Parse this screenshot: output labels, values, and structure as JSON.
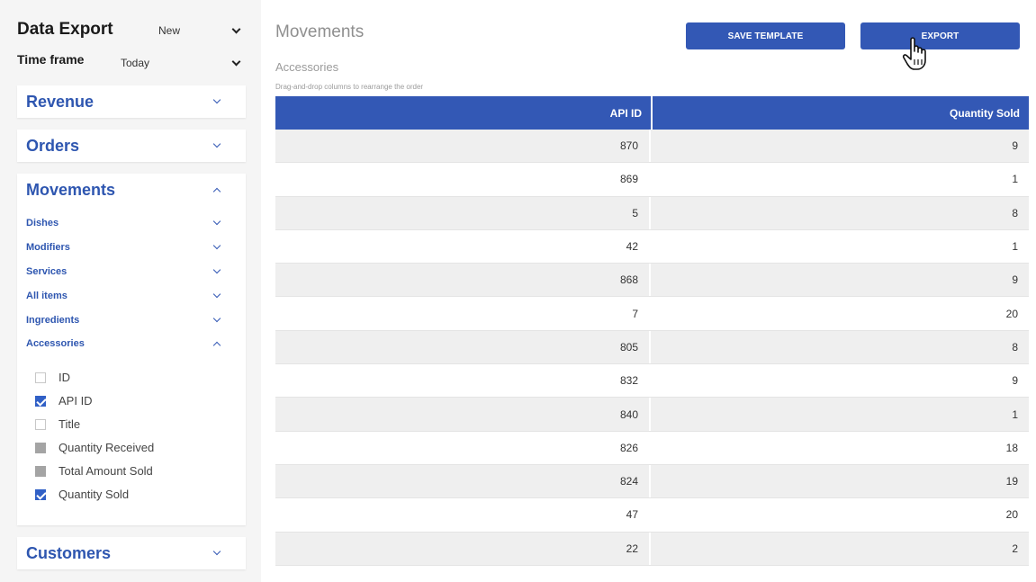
{
  "sidebar": {
    "title": "Data Export",
    "template_select": "New",
    "timeframe_label": "Time frame",
    "timeframe_select": "Today",
    "sections": {
      "revenue": "Revenue",
      "orders": "Orders",
      "movements": "Movements",
      "customers": "Customers"
    },
    "movement_items": [
      "Dishes",
      "Modifiers",
      "Services",
      "All items",
      "Ingredients",
      "Accessories"
    ],
    "fields": [
      {
        "label": "ID",
        "state": "unchecked"
      },
      {
        "label": "API ID",
        "state": "checked"
      },
      {
        "label": "Title",
        "state": "unchecked"
      },
      {
        "label": "Quantity Received",
        "state": "disabled"
      },
      {
        "label": "Total Amount Sold",
        "state": "disabled"
      },
      {
        "label": "Quantity Sold",
        "state": "checked"
      }
    ]
  },
  "main": {
    "title": "Movements",
    "save_template_label": "SAVE TEMPLATE",
    "export_label": "EXPORT",
    "breadcrumb": "Accessories",
    "hint": "Drag-and-drop columns to rearrange the order",
    "columns": [
      "API ID",
      "Quantity Sold"
    ],
    "rows": [
      [
        "870",
        "9"
      ],
      [
        "869",
        "1"
      ],
      [
        "5",
        "8"
      ],
      [
        "42",
        "1"
      ],
      [
        "868",
        "9"
      ],
      [
        "7",
        "20"
      ],
      [
        "805",
        "8"
      ],
      [
        "832",
        "9"
      ],
      [
        "840",
        "1"
      ],
      [
        "826",
        "18"
      ],
      [
        "824",
        "19"
      ],
      [
        "47",
        "20"
      ],
      [
        "22",
        "2"
      ]
    ]
  },
  "colors": {
    "accent": "#3358b5",
    "sidebar_bg": "#f5f5f5",
    "row_alt": "#efefef"
  },
  "icons": {
    "dropdown": "chevron-down-icon",
    "collapse": "chevron-up-icon",
    "cursor": "hand-pointer-icon"
  }
}
